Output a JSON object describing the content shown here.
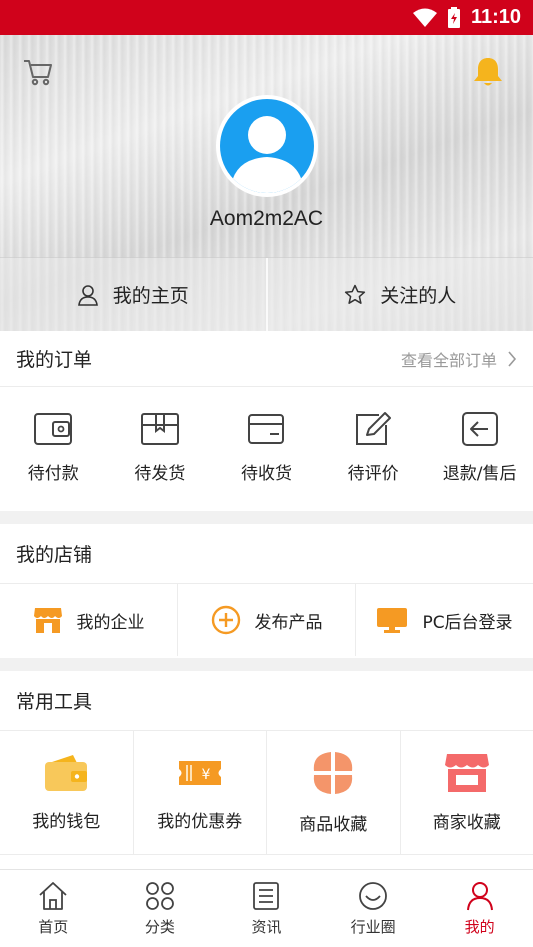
{
  "status_bar": {
    "time": "11:10"
  },
  "profile": {
    "username": "Aom2m2AC"
  },
  "hero_tabs": [
    {
      "label": "我的主页",
      "icon": "person-icon"
    },
    {
      "label": "关注的人",
      "icon": "star-icon"
    }
  ],
  "orders": {
    "title": "我的订单",
    "view_all": "查看全部订单",
    "items": [
      {
        "label": "待付款",
        "icon": "wallet-icon"
      },
      {
        "label": "待发货",
        "icon": "box-icon"
      },
      {
        "label": "待收货",
        "icon": "card-icon"
      },
      {
        "label": "待评价",
        "icon": "edit-icon"
      },
      {
        "label": "退款/售后",
        "icon": "return-icon"
      }
    ]
  },
  "shop": {
    "title": "我的店铺",
    "items": [
      {
        "label": "我的企业",
        "icon": "store-icon"
      },
      {
        "label": "发布产品",
        "icon": "plus-circle-icon"
      },
      {
        "label": "PC后台登录",
        "icon": "monitor-icon"
      }
    ]
  },
  "tools": {
    "title": "常用工具",
    "items": [
      {
        "label": "我的钱包",
        "icon": "purse-icon"
      },
      {
        "label": "我的优惠券",
        "icon": "coupon-icon"
      },
      {
        "label": "商品收藏",
        "icon": "clover-icon"
      },
      {
        "label": "商家收藏",
        "icon": "shop-icon"
      }
    ]
  },
  "tabbar": [
    {
      "label": "首页",
      "icon": "home-icon"
    },
    {
      "label": "分类",
      "icon": "grid-icon"
    },
    {
      "label": "资讯",
      "icon": "news-icon"
    },
    {
      "label": "行业圈",
      "icon": "circle-icon"
    },
    {
      "label": "我的",
      "icon": "user-icon",
      "active": true
    }
  ],
  "colors": {
    "accent": "#d0021b",
    "bell": "#f5b41d",
    "avatar_bg": "#1a9ff0",
    "orange": "#f59a23",
    "coral": "#f46a6a"
  }
}
